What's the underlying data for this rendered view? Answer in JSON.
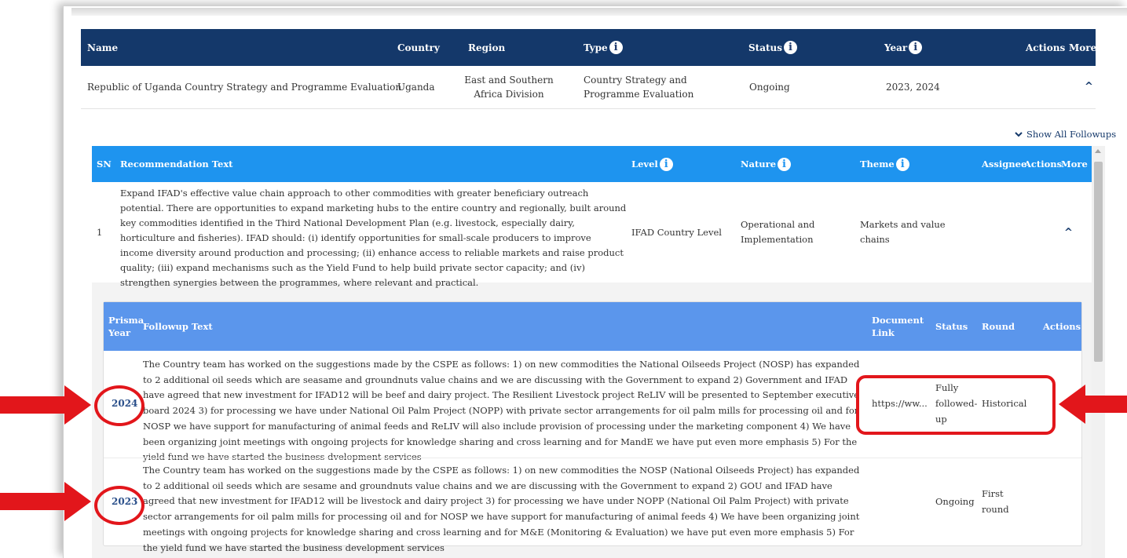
{
  "main_table": {
    "headers": {
      "name": "Name",
      "country": "Country",
      "region": "Region",
      "type": "Type",
      "status": "Status",
      "year": "Year",
      "actions": "Actions",
      "more": "More"
    },
    "row": {
      "name": "Republic of Uganda Country Strategy and Programme Evaluation",
      "country": "Uganda",
      "region": "East and Southern Africa Division",
      "type": "Country Strategy and Programme Evaluation",
      "status": "Ongoing",
      "year": "2023, 2024"
    }
  },
  "show_all_followups": "Show All Followups",
  "recommendation_table": {
    "headers": {
      "sn": "SN",
      "text": "Recommendation Text",
      "level": "Level",
      "nature": "Nature",
      "theme": "Theme",
      "assignee": "Assignee",
      "actions": "Actions",
      "more": "More"
    },
    "row": {
      "sn": "1",
      "text": "Expand IFAD's effective value chain approach to other commodities with greater beneficiary outreach potential. There are opportunities to expand marketing hubs to the entire country and regionally, built around key commodities identified in the Third National Development Plan (e.g. livestock, especially dairy, horticulture and fisheries). IFAD should: (i) identify opportunities for small-scale producers to improve income diversity around production and processing; (ii) enhance access to reliable markets and raise product quality; (iii) expand mechanisms such as the Yield Fund to help build private sector capacity; and (iv) strengthen synergies between the programmes, where relevant and practical.",
      "level": "IFAD Country Level",
      "nature": "Operational and Implementation",
      "theme": "Markets and value chains"
    }
  },
  "followup_table": {
    "headers": {
      "prisma_year": "Prisma Year",
      "text": "Followup Text",
      "document_link": "Document Link",
      "status": "Status",
      "round": "Round",
      "actions": "Actions"
    },
    "rows": [
      {
        "year": "2024",
        "text": "The Country team has worked on the suggestions made by the CSPE as follows: 1) on new commodities the National Oilseeds Project (NOSP) has expanded to 2 additional oil seeds which are seasame and groundnuts value chains and we are discussing with the Government to expand 2) Government and IFAD have agreed that new investment for IFAD12 will be beef and dairy project. The Resilient Livestock project ReLIV will be presented to September executive board 2024 3) for processing we have under National Oil Palm Project (NOPP) with private sector arrangements for oil palm mills for processing oil and for NOSP we have support for manufacturing of animal feeds and ReLIV will also include provision of processing under the marketing component 4) We have been organizing joint meetings with ongoing projects for knowledge sharing and cross learning and for MandE we have put even more emphasis 5) For the yield fund we have started the business dvelopment services",
        "document_link": "https://ww...",
        "status": "Fully followed-up",
        "round": "Historical"
      },
      {
        "year": "2023",
        "text": "The Country team has worked on the suggestions made by the CSPE as follows: 1) on new commodities the NOSP (National Oilseeds Project) has expanded to 2 additional oil seeds which are sesame and groundnuts value chains and we are discussing with the Government to expand 2) GOU and IFAD have agreed that new investment for IFAD12 will be livestock and dairy project 3) for processing we have under NOPP (National Oil Palm Project) with private sector arrangements for oil palm mills for processing oil and for NOSP we have support for manufacturing of animal feeds 4) We have been organizing joint meetings with ongoing projects for knowledge sharing and cross learning and for M&E (Monitoring & Evaluation) we have put even more emphasis 5) For the yield fund we have started the business development services",
        "document_link": "",
        "status": "Ongoing",
        "round": "First round"
      }
    ]
  },
  "icons": {
    "info": "i",
    "chevron_up": "^",
    "chevron_down": "chevron-down"
  },
  "colors": {
    "main_header_bg": "#14386a",
    "rec_header_bg": "#1e94ef",
    "followup_header_bg": "#5b96ec",
    "highlight_red": "#e2161b"
  }
}
